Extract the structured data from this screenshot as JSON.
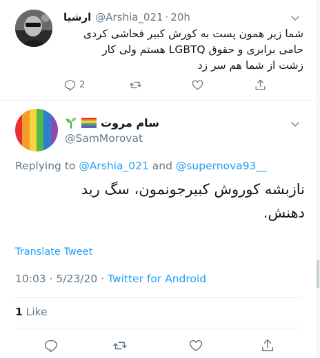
{
  "reply_tweet": {
    "display_name": "ارشیا",
    "handle": "@Arshia_021",
    "separator": "·",
    "time": "20h",
    "text_lines": [
      "شما زیر همون پست به کورش کبیر فحاشی کردی",
      "حامی برابری و حقوق LGBTQ هستم ولی کار",
      "زشت از شما هم سر زد"
    ],
    "reply_count": "2",
    "icons": [
      "reply-icon",
      "retweet-icon",
      "like-icon",
      "share-icon",
      "chevron-down-icon"
    ]
  },
  "main_tweet": {
    "display_name": "سام مروت",
    "handle": "@SamMorovat",
    "replying": {
      "prefix": "Replying to ",
      "mention1": "@Arshia_021",
      "conjunction": " and ",
      "mention2": "@supernova93__"
    },
    "text_lines": [
      "نازبشه کوروش کبیرجونمون، سگ رید",
      "دهنش."
    ],
    "translate_label": "Translate Tweet",
    "timestamp": "10:03 · 5/23/20",
    "meta_separator": " · ",
    "source": "Twitter for Android",
    "like_count": "1",
    "like_label": " Like",
    "icons": [
      "reply-icon",
      "retweet-icon",
      "like-icon",
      "share-icon",
      "chevron-down-icon",
      "seedling-icon",
      "rainbow-flag-icon"
    ]
  },
  "colors": {
    "link": "#1da1f2",
    "muted": "#657786",
    "text": "#14171a",
    "divider": "#e6ecf0",
    "avatar_stripes": [
      "#e8312f",
      "#f39c2c",
      "#f7d53c",
      "#52b848",
      "#2f7fd1",
      "#8c4bb0"
    ]
  }
}
